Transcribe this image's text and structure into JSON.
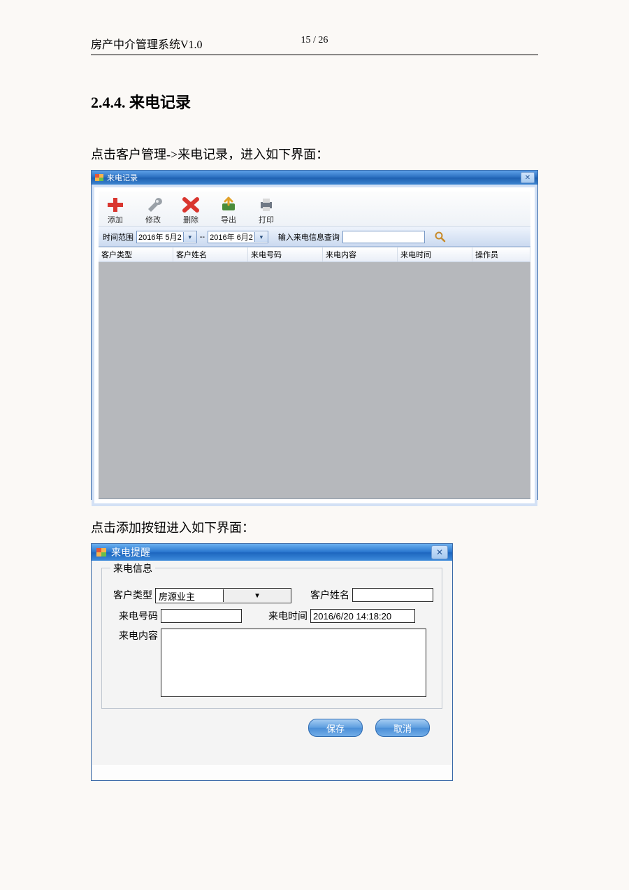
{
  "doc": {
    "header_title": "房产中介管理系统V1.0",
    "page_indicator": "15 / 26",
    "section_number": "2.4.4.",
    "section_title": "来电记录",
    "para1": "点击客户管理->来电记录，进入如下界面：",
    "para2": "点击添加按钮进入如下界面："
  },
  "win1": {
    "title": "来电记录",
    "toolbar": {
      "add": "添加",
      "edit": "修改",
      "delete": "删除",
      "export": "导出",
      "print": "打印"
    },
    "filter": {
      "range_label": "时间范围",
      "date_from": "2016年 5月2",
      "date_to": "2016年 6月2",
      "range_sep": "--",
      "search_label": "输入来电信息查询",
      "search_value": ""
    },
    "columns": [
      "客户类型",
      "客户姓名",
      "来电号码",
      "来电内容",
      "来电时间",
      "操作员"
    ]
  },
  "win2": {
    "title": "来电提醒",
    "fieldset_title": "来电信息",
    "labels": {
      "type": "客户类型",
      "name": "客户姓名",
      "phone": "来电号码",
      "time": "来电时间",
      "content": "来电内容"
    },
    "values": {
      "type": "房源业主",
      "name": "",
      "phone": "",
      "time": "2016/6/20 14:18:20",
      "content": ""
    },
    "buttons": {
      "save": "保存",
      "cancel": "取消"
    }
  }
}
